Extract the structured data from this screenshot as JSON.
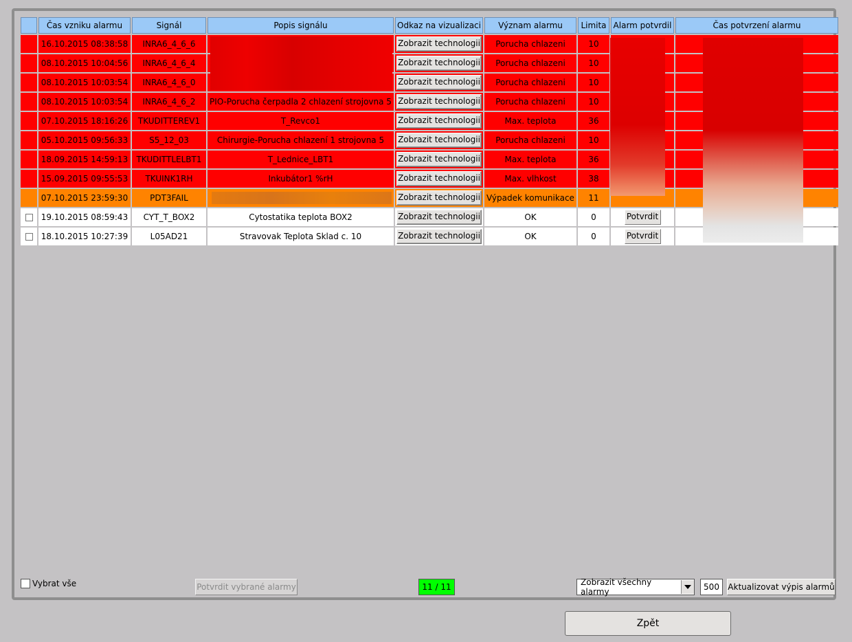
{
  "columns": [
    "",
    "Čas vzniku alarmu",
    "Signál",
    "Popis signálu",
    "Odkaz na vizualizaci",
    "Význam alarmu",
    "Limita",
    "Alarm potvrdil",
    "Čas potvrzení alarmu"
  ],
  "rows": [
    {
      "state": "red",
      "time": "16.10.2015 08:38:58",
      "signal": "INRA6_4_6_6",
      "desc": "",
      "link": "Zobrazit technologii",
      "meaning": "Porucha chlazeni",
      "limit": "10",
      "confirmed_by": "",
      "confirm_time": "",
      "confirm": ""
    },
    {
      "state": "red",
      "time": "08.10.2015 10:04:56",
      "signal": "INRA6_4_6_4",
      "desc": "",
      "link": "Zobrazit technologii",
      "meaning": "Porucha chlazeni",
      "limit": "10",
      "confirmed_by": "",
      "confirm_time": "",
      "confirm": ""
    },
    {
      "state": "red",
      "time": "08.10.2015 10:03:54",
      "signal": "INRA6_4_6_0",
      "desc": "",
      "link": "Zobrazit technologii",
      "meaning": "Porucha chlazeni",
      "limit": "10",
      "confirmed_by": "",
      "confirm_time": "",
      "confirm": ""
    },
    {
      "state": "red",
      "time": "08.10.2015 10:03:54",
      "signal": "INRA6_4_6_2",
      "desc": "PIO-Porucha čerpadla 2 chlazení strojovna 5",
      "link": "Zobrazit technologii",
      "meaning": "Porucha chlazeni",
      "limit": "10",
      "confirmed_by": "",
      "confirm_time": "",
      "confirm": ""
    },
    {
      "state": "red",
      "time": "07.10.2015 18:16:26",
      "signal": "TKUDITTEREV1",
      "desc": "T_Revco1",
      "link": "Zobrazit technologii",
      "meaning": "Max. teplota",
      "limit": "36",
      "confirmed_by": "",
      "confirm_time": "",
      "confirm": ""
    },
    {
      "state": "red",
      "time": "05.10.2015 09:56:33",
      "signal": "S5_12_03",
      "desc": "Chirurgie-Porucha chlazení 1 strojovna 5",
      "link": "Zobrazit technologii",
      "meaning": "Porucha chlazeni",
      "limit": "10",
      "confirmed_by": "",
      "confirm_time": "",
      "confirm": ""
    },
    {
      "state": "red",
      "time": "18.09.2015 14:59:13",
      "signal": "TKUDITTLELBT1",
      "desc": "T_Lednice_LBT1",
      "link": "Zobrazit technologii",
      "meaning": "Max. teplota",
      "limit": "36",
      "confirmed_by": "",
      "confirm_time": "",
      "confirm": ""
    },
    {
      "state": "red",
      "time": "15.09.2015 09:55:53",
      "signal": "TKUINK1RH",
      "desc": "Inkubátor1 %rH",
      "link": "Zobrazit technologii",
      "meaning": "Max. vlhkost",
      "limit": "38",
      "confirmed_by": "",
      "confirm_time": "",
      "confirm": ""
    },
    {
      "state": "orange",
      "time": "07.10.2015 23:59:30",
      "signal": "PDT3FAIL",
      "desc": "",
      "link": "Zobrazit technologii",
      "meaning": "Výpadek komunikace",
      "limit": "11",
      "confirmed_by": "",
      "confirm_time": "",
      "confirm": ""
    },
    {
      "state": "white",
      "time": "19.10.2015 08:59:43",
      "signal": "CYT_T_BOX2",
      "desc": "Cytostatika teplota BOX2",
      "link": "Zobrazit technologii",
      "meaning": "OK",
      "limit": "0",
      "confirmed_by": "",
      "confirm_time": "",
      "confirm": "Potvrdit"
    },
    {
      "state": "white",
      "time": "18.10.2015 10:27:39",
      "signal": "L05AD21",
      "desc": "Stravovak Teplota Sklad c. 10",
      "link": "Zobrazit technologii",
      "meaning": "OK",
      "limit": "0",
      "confirmed_by": "",
      "confirm_time": "",
      "confirm": "Potvrdit"
    }
  ],
  "footer": {
    "select_all_label": "Vybrat vše",
    "confirm_selected_label": "Potvrdit vybrané alarmy",
    "counter": "11 / 11",
    "filter_value": "Zobrazit všechny alarmy",
    "limit_value": "500",
    "refresh_label": "Aktualizovat výpis alarmů",
    "back_label": "Zpět"
  },
  "colors": {
    "header": "#9bc9f7",
    "alarm": "#ff0000",
    "warning": "#ff8300",
    "ok": "#ffffff",
    "counter": "#00ff00",
    "background": "#c4c2c4"
  }
}
